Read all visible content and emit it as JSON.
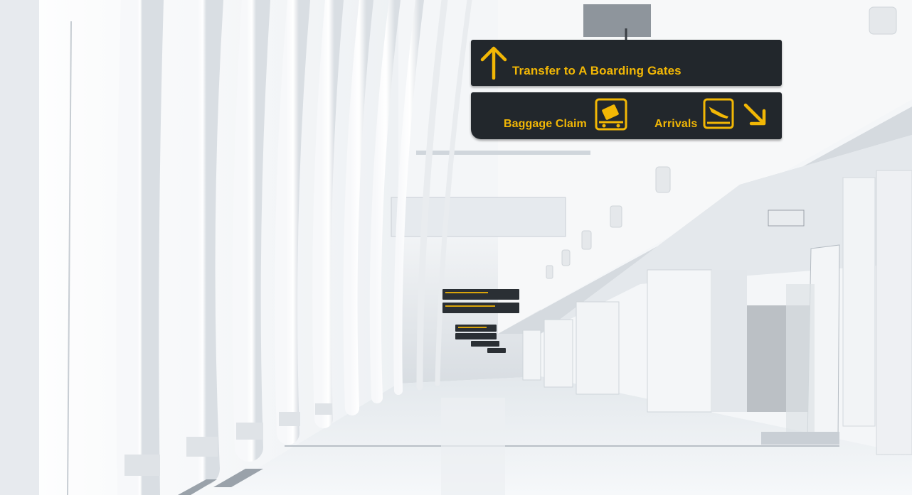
{
  "signs": {
    "top": {
      "label": "Transfer to A Boarding Gates",
      "icon": "arrow-up-icon"
    },
    "bottom": {
      "baggage_label": "Baggage Claim",
      "baggage_icon": "baggage-claim-icon",
      "arrivals_label": "Arrivals",
      "arrivals_icon": "arrivals-plane-icon",
      "direction_icon": "arrow-down-right-icon"
    }
  },
  "colors": {
    "sign_background": "#22272c",
    "sign_text": "#f2b705",
    "hall": "#f4f6f8"
  }
}
